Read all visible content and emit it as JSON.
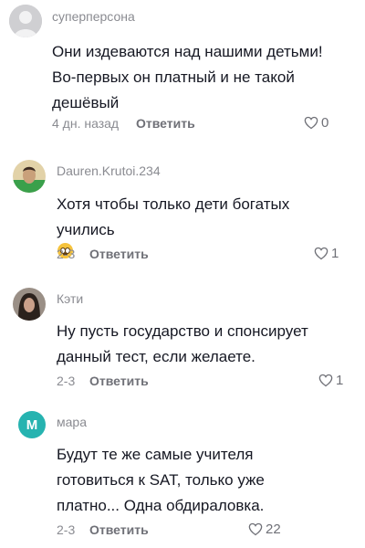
{
  "comments": [
    {
      "username": "суперперсона",
      "lines": [
        "Они издеваются над нашими детьми!",
        "Во-первых он платный и не такой",
        "дешёвый"
      ],
      "time": "4 дн. назад",
      "reply_label": "Ответить",
      "likes": "0"
    },
    {
      "username": "Dauren.Krutoi.234",
      "lines": [
        "Хотя чтобы только дети богатых",
        "учились"
      ],
      "emoji": "flushed-face",
      "time": "2-3",
      "reply_label": "Ответить",
      "likes": "1"
    },
    {
      "username": "Кэти",
      "lines": [
        "Ну пусть государство и спонсирует",
        "данный тест, если желаете."
      ],
      "time": "2-3",
      "reply_label": "Ответить",
      "likes": "1"
    },
    {
      "username": "мара",
      "avatar_letter": "M",
      "lines": [
        "Будут те же самые учителя",
        "готовиться к SAT, только уже",
        "платно... Одна обдираловка."
      ],
      "time": "2-3",
      "reply_label": "Ответить",
      "likes": "22"
    }
  ],
  "colors": {
    "avatar_mara": "#26b3b0",
    "meta_text": "#8a8b91",
    "body_text": "#161823"
  }
}
